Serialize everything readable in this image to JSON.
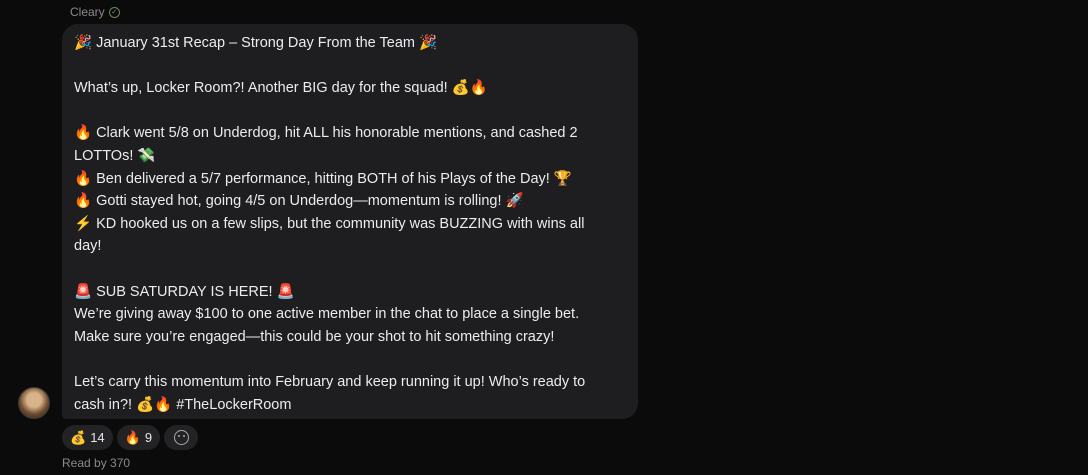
{
  "sender": {
    "name": "Cleary",
    "badge_icon": "verified-icon"
  },
  "message": {
    "lines": [
      "🎉 January 31st Recap – Strong Day From the Team 🎉",
      "",
      "What’s up, Locker Room?! Another BIG day for the squad! 💰🔥",
      "",
      "🔥 Clark went 5/8 on Underdog, hit ALL his honorable mentions, and cashed 2",
      "LOTTOs! 💸",
      "🔥 Ben delivered a 5/7 performance, hitting BOTH of his Plays of the Day! 🏆",
      "🔥 Gotti stayed hot, going 4/5 on Underdog—momentum is rolling! 🚀",
      "⚡ KD hooked us on a few slips, but the community was BUZZING with wins all",
      "day!",
      "",
      "🚨 SUB SATURDAY IS HERE! 🚨",
      "We’re giving away $100 to one active member in the chat to place a single bet.",
      "Make sure you’re engaged—this could be your shot to hit something crazy!",
      "",
      "Let’s carry this momentum into February and keep running it up! Who’s ready to",
      "cash in?! 💰🔥 #TheLockerRoom"
    ]
  },
  "reactions": [
    {
      "emoji": "💰",
      "count": "14"
    },
    {
      "emoji": "🔥",
      "count": "9"
    }
  ],
  "read_by": "Read by 370"
}
